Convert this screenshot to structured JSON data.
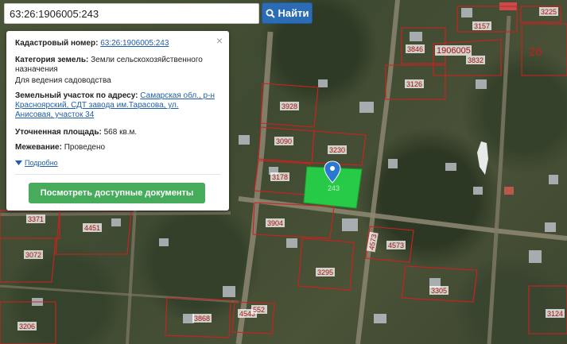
{
  "search": {
    "value": "63:26:1906005:243",
    "button_label": "Найти",
    "icon": "search-icon"
  },
  "popup": {
    "close_symbol": "×",
    "cadastral_label": "Кадастровый номер:",
    "cadastral_value": "63:26:1906005:243",
    "category_label": "Категория земель:",
    "category_value": "Земли сельскохозяйственного назначения",
    "usage_value": "Для ведения садоводства",
    "address_label": "Земельный участок по адресу:",
    "address_value": "Самарская обл., р-н Красноярский, СДТ завода им.Тарасова, ул. Анисовая, участок 34",
    "area_label": "Уточненная площадь:",
    "area_value": "568 кв.м.",
    "survey_label": "Межевание:",
    "survey_value": "Проведено",
    "details_label": "Подробно",
    "docs_button": "Посмотреть доступные документы"
  },
  "map": {
    "highlight_color": "#22e04a",
    "boundary_color": "#d21f1f",
    "marker_color": "#2b78d2",
    "parcel_labels": [
      "3225",
      "3157",
      "3846",
      "1906005",
      "3832",
      "26",
      "3126",
      "3928",
      "3090",
      "3230",
      "3178",
      "3371",
      "4451",
      "3904",
      "4573",
      "4573",
      "3072",
      "3295",
      "3305",
      "3206",
      "3868",
      "4543",
      "552",
      "3124"
    ],
    "selected_parcel_label": "243"
  }
}
